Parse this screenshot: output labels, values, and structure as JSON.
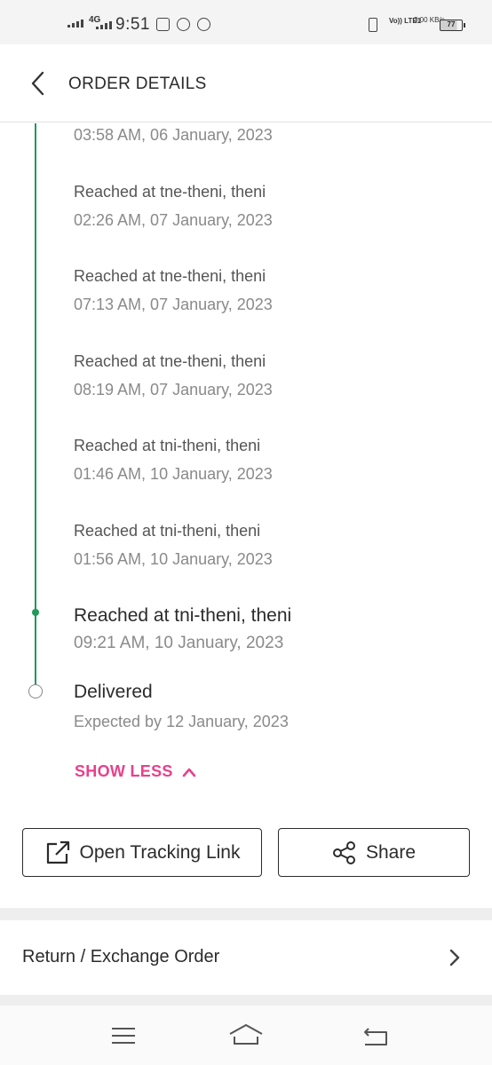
{
  "status_bar": {
    "network": "4G",
    "time": "9:51",
    "lte": "Vo)) LTE1",
    "speed": "3.00 KB/s",
    "battery": "77"
  },
  "header": {
    "title": "ORDER DETAILS"
  },
  "timeline": {
    "first_time": "03:58 AM, 06 January, 2023",
    "events": [
      {
        "title": "Reached at tne-theni, theni",
        "time": "02:26 AM, 07 January, 2023"
      },
      {
        "title": "Reached at tne-theni, theni",
        "time": "07:13 AM, 07 January, 2023"
      },
      {
        "title": "Reached at tne-theni, theni",
        "time": "08:19 AM, 07 January, 2023"
      },
      {
        "title": "Reached at tni-theni, theni",
        "time": "01:46 AM, 10 January, 2023"
      },
      {
        "title": "Reached at tni-theni, theni",
        "time": "01:56 AM, 10 January, 2023"
      }
    ],
    "current": {
      "title": "Reached at tni-theni, theni",
      "time": "09:21 AM, 10 January, 2023"
    },
    "delivered": {
      "title": "Delivered",
      "time": "Expected by 12 January, 2023"
    },
    "show_less": "SHOW LESS"
  },
  "actions": {
    "track_label": "Open Tracking Link",
    "share_label": "Share"
  },
  "return_row": {
    "label": "Return / Exchange Order"
  },
  "colors": {
    "accent_pink": "#e8418b",
    "timeline_green": "#1f9a5a"
  }
}
